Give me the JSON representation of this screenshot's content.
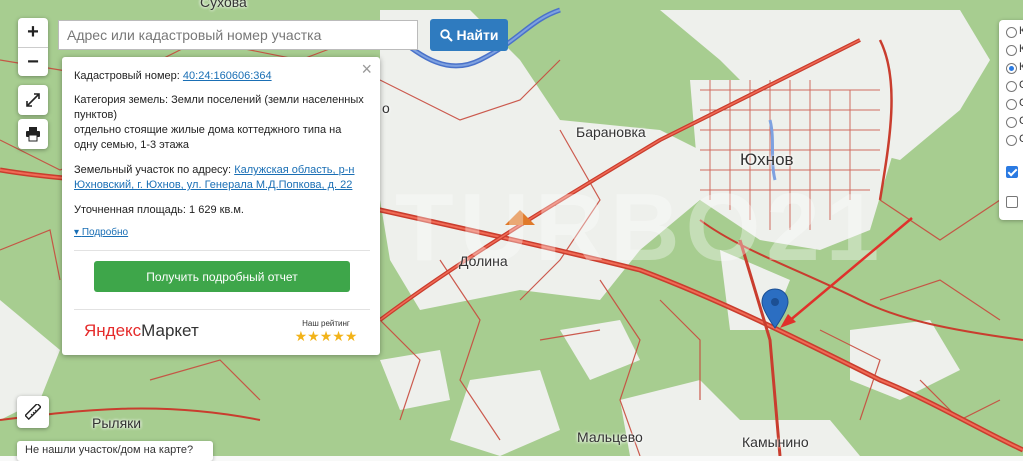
{
  "search": {
    "placeholder": "Адрес или кадастровый номер участка",
    "button_label": "Найти"
  },
  "zoom": {
    "in_label": "+",
    "out_label": "−"
  },
  "popup": {
    "close_label": "×",
    "cadastral_label": "Кадастровый номер:",
    "cadastral_number": "40:24:160606:364",
    "category_label": "Категория земель:",
    "category_value": "Земли поселений (земли населенных пунктов)",
    "use_text": "отдельно стоящие жилые дома коттеджного типа на одну семью, 1-3 этажа",
    "address_label": "Земельный участок по адресу:",
    "address_value": "Калужская область, р-н Юхновский, г. Юхнов, ул. Генерала М.Д.Попкова, д. 22",
    "area_label": "Уточненная площадь:",
    "area_value": "1 629",
    "area_unit": "кв.м.",
    "more_label": "Подробно",
    "report_button": "Получить подробный отчет",
    "market_logo_y": "Яндекс",
    "market_logo_m": "Маркет",
    "rating_label": "Наш рейтинг",
    "rating_stars": "★★★★★"
  },
  "layers": {
    "options": [
      {
        "label": "К",
        "selected": false
      },
      {
        "label": "К",
        "selected": false
      },
      {
        "label": "К",
        "selected": true
      },
      {
        "label": "С",
        "selected": false
      },
      {
        "label": "С",
        "selected": false
      },
      {
        "label": "С",
        "selected": false
      },
      {
        "label": "С",
        "selected": false
      }
    ],
    "checkboxes": [
      {
        "checked": true
      },
      {
        "checked": false
      }
    ]
  },
  "map": {
    "places": {
      "top": "Сухова",
      "baranovka": "Барановка",
      "yukhnov": "Юхнов",
      "dolina": "Долина",
      "ryliaki": "Рыляки",
      "maltsevo": "Мальцево",
      "kamynino": "Камынино",
      "o_fragment": "о"
    },
    "watermark": "TURBO21"
  },
  "notfound_label": "Не нашли участок/дом на карте?",
  "icons": {
    "search": "search-icon",
    "fullscreen": "fullscreen-icon",
    "print": "print-icon",
    "ruler": "ruler-icon",
    "marker": "map-marker-icon",
    "arrow": "red-arrow-icon"
  },
  "colors": {
    "forest": "#a5cc8f",
    "field": "#eff1ee",
    "road": "#d1483a",
    "river": "#4a72c9",
    "button_blue": "#2f7bbf",
    "button_green": "#3ea64a",
    "marker": "#2b6ec2"
  }
}
